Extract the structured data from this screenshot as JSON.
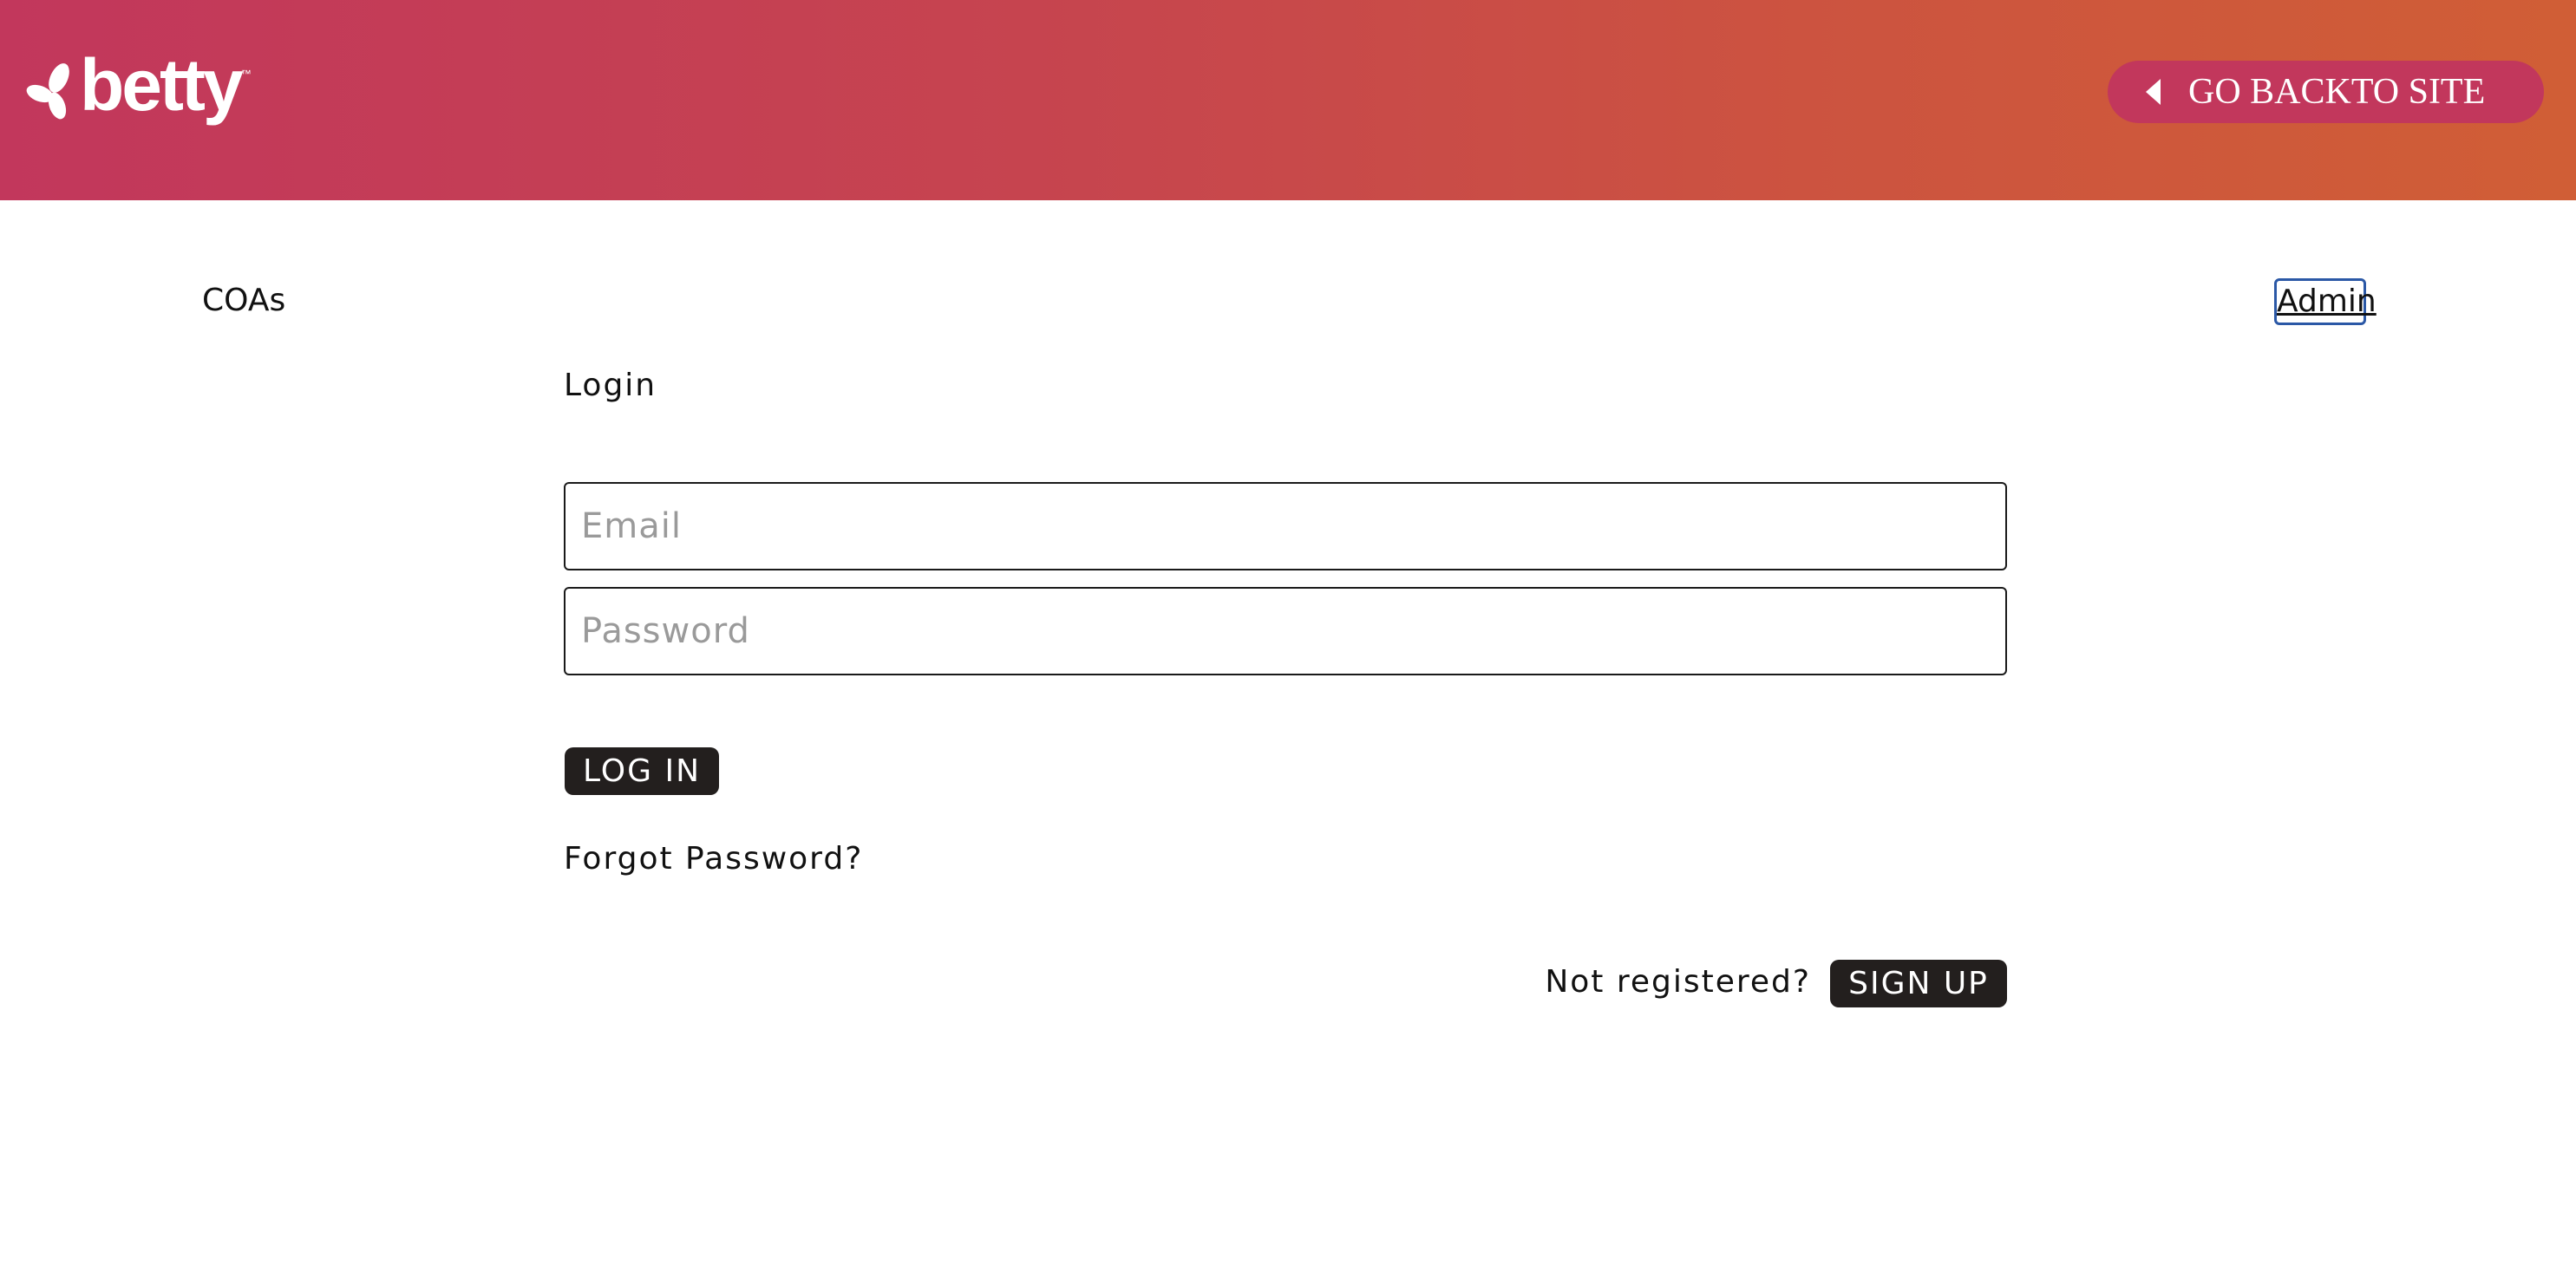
{
  "header": {
    "logo_text": "betty",
    "logo_tm": "™",
    "back_button_label": "GO BACKTO SITE"
  },
  "nav": {
    "left_link": "COAs",
    "right_link": "Admin"
  },
  "login": {
    "title": "Login",
    "email_placeholder": "Email",
    "password_placeholder": "Password",
    "login_button": "LOG IN",
    "forgot_link": "Forgot Password?",
    "not_registered_text": "Not registered?",
    "signup_button": "SIGN UP"
  },
  "colors": {
    "header_gradient_start": "#c2375c",
    "header_gradient_end": "#d05e36",
    "back_button_bg": "#c2375c",
    "dark_button_bg": "#231f1e",
    "focus_outline": "#2b58a6"
  }
}
